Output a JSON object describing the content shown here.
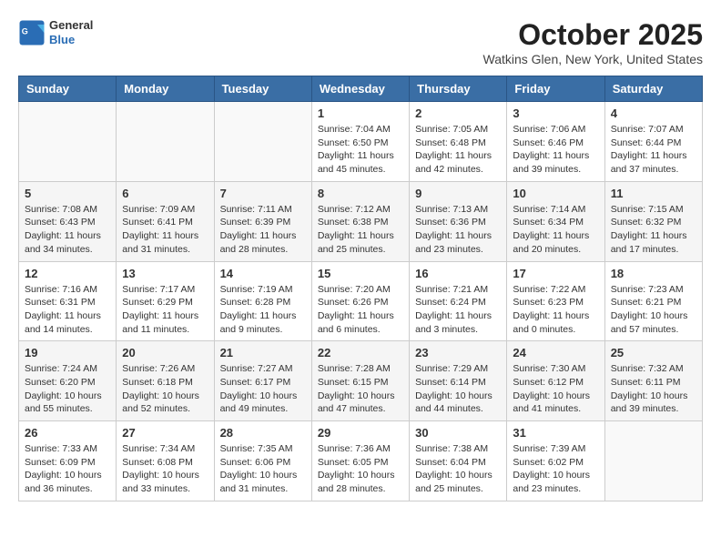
{
  "header": {
    "logo_general": "General",
    "logo_blue": "Blue",
    "month_title": "October 2025",
    "location": "Watkins Glen, New York, United States"
  },
  "days_of_week": [
    "Sunday",
    "Monday",
    "Tuesday",
    "Wednesday",
    "Thursday",
    "Friday",
    "Saturday"
  ],
  "weeks": [
    [
      {
        "num": "",
        "info": ""
      },
      {
        "num": "",
        "info": ""
      },
      {
        "num": "",
        "info": ""
      },
      {
        "num": "1",
        "info": "Sunrise: 7:04 AM\nSunset: 6:50 PM\nDaylight: 11 hours and 45 minutes."
      },
      {
        "num": "2",
        "info": "Sunrise: 7:05 AM\nSunset: 6:48 PM\nDaylight: 11 hours and 42 minutes."
      },
      {
        "num": "3",
        "info": "Sunrise: 7:06 AM\nSunset: 6:46 PM\nDaylight: 11 hours and 39 minutes."
      },
      {
        "num": "4",
        "info": "Sunrise: 7:07 AM\nSunset: 6:44 PM\nDaylight: 11 hours and 37 minutes."
      }
    ],
    [
      {
        "num": "5",
        "info": "Sunrise: 7:08 AM\nSunset: 6:43 PM\nDaylight: 11 hours and 34 minutes."
      },
      {
        "num": "6",
        "info": "Sunrise: 7:09 AM\nSunset: 6:41 PM\nDaylight: 11 hours and 31 minutes."
      },
      {
        "num": "7",
        "info": "Sunrise: 7:11 AM\nSunset: 6:39 PM\nDaylight: 11 hours and 28 minutes."
      },
      {
        "num": "8",
        "info": "Sunrise: 7:12 AM\nSunset: 6:38 PM\nDaylight: 11 hours and 25 minutes."
      },
      {
        "num": "9",
        "info": "Sunrise: 7:13 AM\nSunset: 6:36 PM\nDaylight: 11 hours and 23 minutes."
      },
      {
        "num": "10",
        "info": "Sunrise: 7:14 AM\nSunset: 6:34 PM\nDaylight: 11 hours and 20 minutes."
      },
      {
        "num": "11",
        "info": "Sunrise: 7:15 AM\nSunset: 6:32 PM\nDaylight: 11 hours and 17 minutes."
      }
    ],
    [
      {
        "num": "12",
        "info": "Sunrise: 7:16 AM\nSunset: 6:31 PM\nDaylight: 11 hours and 14 minutes."
      },
      {
        "num": "13",
        "info": "Sunrise: 7:17 AM\nSunset: 6:29 PM\nDaylight: 11 hours and 11 minutes."
      },
      {
        "num": "14",
        "info": "Sunrise: 7:19 AM\nSunset: 6:28 PM\nDaylight: 11 hours and 9 minutes."
      },
      {
        "num": "15",
        "info": "Sunrise: 7:20 AM\nSunset: 6:26 PM\nDaylight: 11 hours and 6 minutes."
      },
      {
        "num": "16",
        "info": "Sunrise: 7:21 AM\nSunset: 6:24 PM\nDaylight: 11 hours and 3 minutes."
      },
      {
        "num": "17",
        "info": "Sunrise: 7:22 AM\nSunset: 6:23 PM\nDaylight: 11 hours and 0 minutes."
      },
      {
        "num": "18",
        "info": "Sunrise: 7:23 AM\nSunset: 6:21 PM\nDaylight: 10 hours and 57 minutes."
      }
    ],
    [
      {
        "num": "19",
        "info": "Sunrise: 7:24 AM\nSunset: 6:20 PM\nDaylight: 10 hours and 55 minutes."
      },
      {
        "num": "20",
        "info": "Sunrise: 7:26 AM\nSunset: 6:18 PM\nDaylight: 10 hours and 52 minutes."
      },
      {
        "num": "21",
        "info": "Sunrise: 7:27 AM\nSunset: 6:17 PM\nDaylight: 10 hours and 49 minutes."
      },
      {
        "num": "22",
        "info": "Sunrise: 7:28 AM\nSunset: 6:15 PM\nDaylight: 10 hours and 47 minutes."
      },
      {
        "num": "23",
        "info": "Sunrise: 7:29 AM\nSunset: 6:14 PM\nDaylight: 10 hours and 44 minutes."
      },
      {
        "num": "24",
        "info": "Sunrise: 7:30 AM\nSunset: 6:12 PM\nDaylight: 10 hours and 41 minutes."
      },
      {
        "num": "25",
        "info": "Sunrise: 7:32 AM\nSunset: 6:11 PM\nDaylight: 10 hours and 39 minutes."
      }
    ],
    [
      {
        "num": "26",
        "info": "Sunrise: 7:33 AM\nSunset: 6:09 PM\nDaylight: 10 hours and 36 minutes."
      },
      {
        "num": "27",
        "info": "Sunrise: 7:34 AM\nSunset: 6:08 PM\nDaylight: 10 hours and 33 minutes."
      },
      {
        "num": "28",
        "info": "Sunrise: 7:35 AM\nSunset: 6:06 PM\nDaylight: 10 hours and 31 minutes."
      },
      {
        "num": "29",
        "info": "Sunrise: 7:36 AM\nSunset: 6:05 PM\nDaylight: 10 hours and 28 minutes."
      },
      {
        "num": "30",
        "info": "Sunrise: 7:38 AM\nSunset: 6:04 PM\nDaylight: 10 hours and 25 minutes."
      },
      {
        "num": "31",
        "info": "Sunrise: 7:39 AM\nSunset: 6:02 PM\nDaylight: 10 hours and 23 minutes."
      },
      {
        "num": "",
        "info": ""
      }
    ]
  ]
}
